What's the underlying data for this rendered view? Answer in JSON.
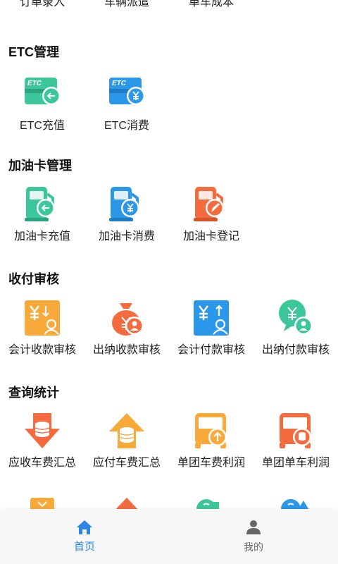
{
  "top_items": [
    "订单录入",
    "车辆派遣",
    "单车成本"
  ],
  "sections": [
    {
      "title": "ETC管理",
      "items": [
        "ETC充值",
        "ETC消费"
      ]
    },
    {
      "title": "加油卡管理",
      "items": [
        "加油卡充值",
        "加油卡消费",
        "加油卡登记"
      ]
    },
    {
      "title": "收付审核",
      "items": [
        "会计收款审核",
        "出纳收款审核",
        "会计付款审核",
        "出纳付款审核"
      ]
    },
    {
      "title": "查询统计",
      "items": [
        "应收车费汇总",
        "应付车费汇总",
        "单团车费利润",
        "单团单车利润"
      ]
    }
  ],
  "etc_card_text": "ETC",
  "tabs": [
    {
      "label": "首页",
      "icon": "home-icon",
      "active": true
    },
    {
      "label": "我的",
      "icon": "person-icon",
      "active": false
    }
  ],
  "colors": {
    "teal": "#3cc79b",
    "blue": "#2b97e8",
    "orange": "#f36b3f",
    "amber": "#f7a93a",
    "active_tab": "#2b86e6",
    "inactive_tab": "#666666"
  }
}
